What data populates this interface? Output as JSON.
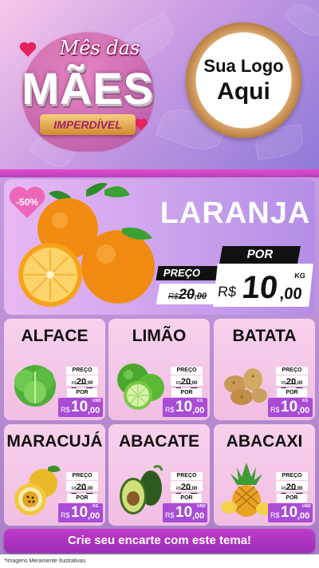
{
  "header": {
    "title_small": "Mês das",
    "title_big": "MÃES",
    "title_ribbon": "IMPERDÍVEL",
    "logo_line1": "Sua Logo",
    "logo_line2": "Aqui"
  },
  "featured": {
    "discount": "-50%",
    "name": "LARANJA",
    "old_label": "PREÇO",
    "old_currency": "R$",
    "old_value": "20",
    "old_cents": ",00",
    "new_label": "POR",
    "new_currency": "R$",
    "new_value": "10",
    "new_cents": ",00",
    "unit": "KG"
  },
  "products": [
    {
      "name": "ALFACE",
      "old_label": "PREÇO",
      "old_currency": "R$",
      "old_value": "20",
      "old_cents": ",00",
      "new_label": "POR",
      "new_currency": "R$",
      "new_value": "10",
      "new_cents": ",00",
      "unit": "UND",
      "icon": "lettuce-icon"
    },
    {
      "name": "LIMÃO",
      "old_label": "PREÇO",
      "old_currency": "R$",
      "old_value": "20",
      "old_cents": ",00",
      "new_label": "POR",
      "new_currency": "R$",
      "new_value": "10",
      "new_cents": ",00",
      "unit": "KG",
      "icon": "lime-icon"
    },
    {
      "name": "BATATA",
      "old_label": "PREÇO",
      "old_currency": "R$",
      "old_value": "20",
      "old_cents": ",00",
      "new_label": "POR",
      "new_currency": "R$",
      "new_value": "10",
      "new_cents": ",00",
      "unit": "KG",
      "icon": "potato-icon"
    },
    {
      "name": "MARACUJÁ",
      "old_label": "PREÇO",
      "old_currency": "R$",
      "old_value": "20",
      "old_cents": ",00",
      "new_label": "POR",
      "new_currency": "R$",
      "new_value": "10",
      "new_cents": ",00",
      "unit": "KG",
      "icon": "passion-fruit-icon"
    },
    {
      "name": "ABACATE",
      "old_label": "PREÇO",
      "old_currency": "R$",
      "old_value": "20",
      "old_cents": ",00",
      "new_label": "POR",
      "new_currency": "R$",
      "new_value": "10",
      "new_cents": ",00",
      "unit": "UND",
      "icon": "avocado-icon"
    },
    {
      "name": "ABACAXI",
      "old_label": "PREÇO",
      "old_currency": "R$",
      "old_value": "20",
      "old_cents": ",00",
      "new_label": "POR",
      "new_currency": "R$",
      "new_value": "10",
      "new_cents": ",00",
      "unit": "UND",
      "icon": "pineapple-icon"
    }
  ],
  "cta": "Crie seu encarte com este tema!",
  "footnote": "*Imagens Meramente Ilustrativas",
  "colors": {
    "accent": "#a84cd6",
    "cta": "#b534c2",
    "band": "#d046c6"
  }
}
